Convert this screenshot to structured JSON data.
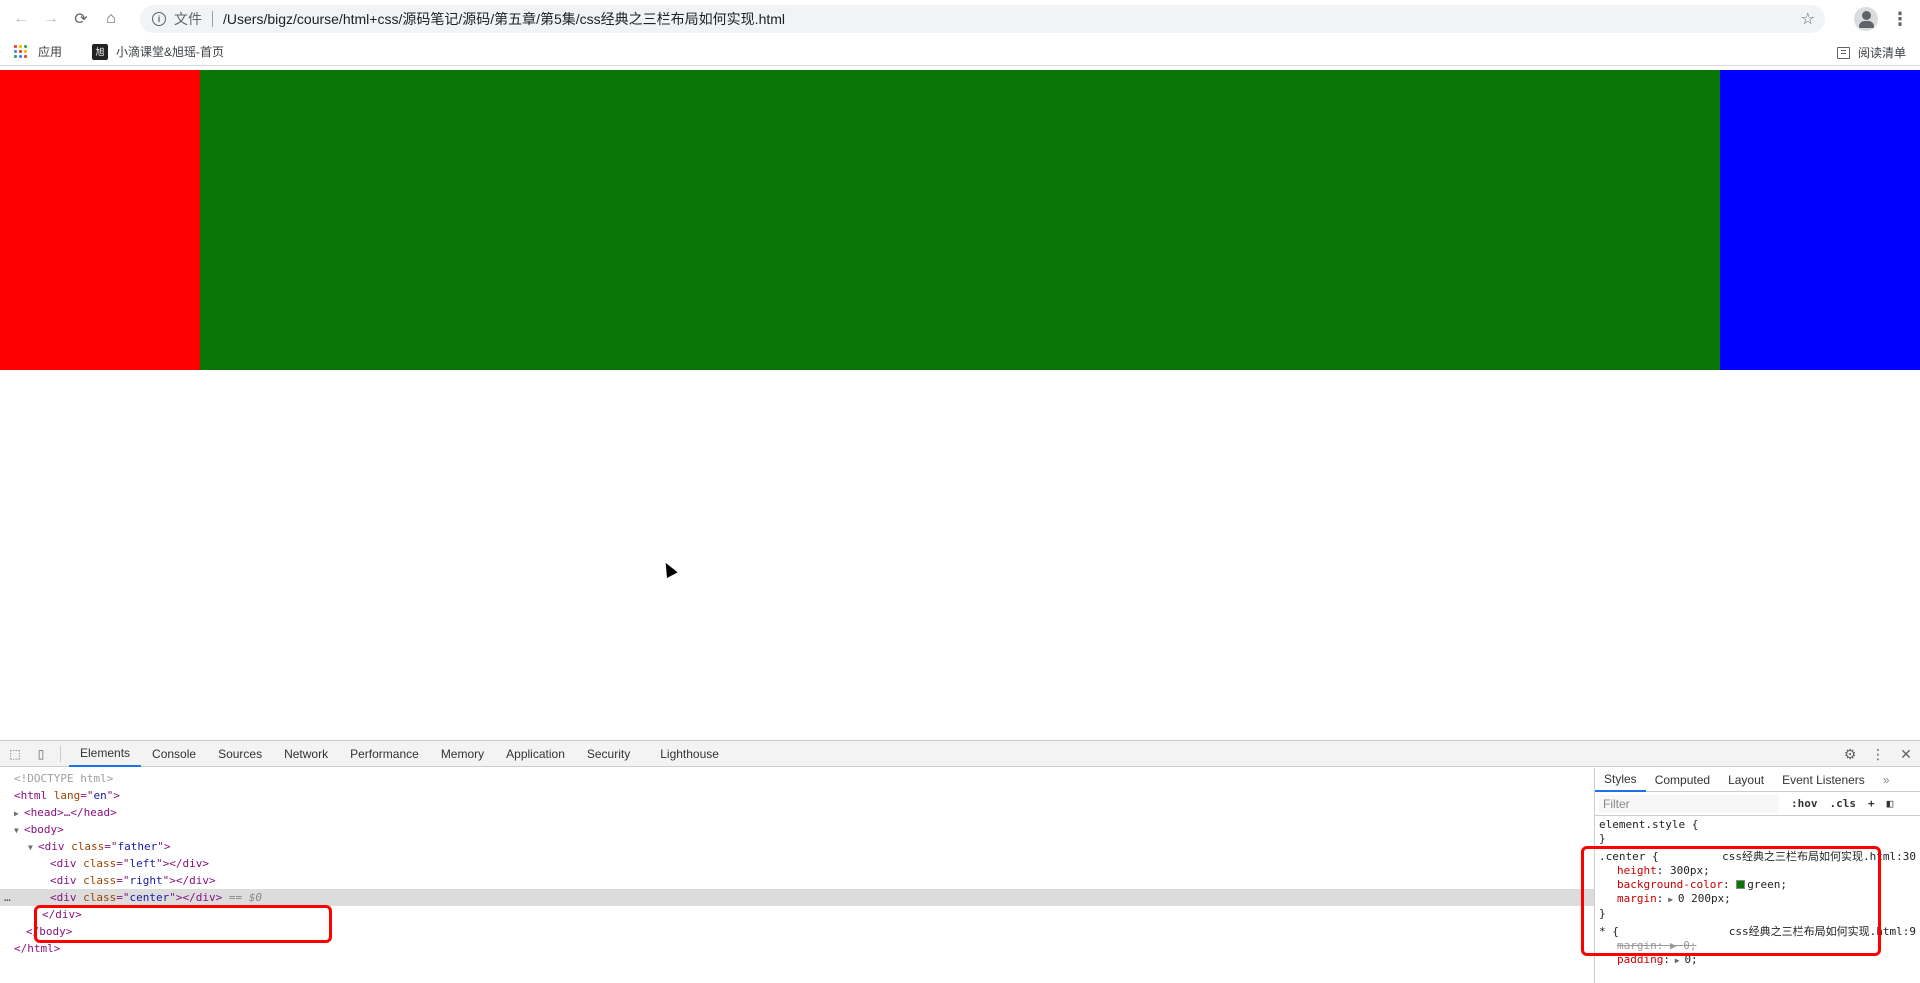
{
  "browser": {
    "protocol_label": "文件",
    "url": "/Users/bigz/course/html+css/源码笔记/源码/第五章/第5集/css经典之三栏布局如何实现.html"
  },
  "bookmarks": {
    "apps_label": "应用",
    "site_label": "小滴课堂&旭瑶-首页",
    "site_logo_text": "旭",
    "reading_list_label": "阅读清单"
  },
  "page": {
    "left_color": "#ff0000",
    "center_color": "#087507",
    "right_color": "#0000ff"
  },
  "devtools": {
    "tabs": [
      "Elements",
      "Console",
      "Sources",
      "Network",
      "Performance",
      "Memory",
      "Application",
      "Security",
      "Lighthouse"
    ],
    "active_tab": "Elements",
    "dom": {
      "doctype": "<!DOCTYPE html>",
      "html_open": "html",
      "html_attr": "lang",
      "html_val": "en",
      "head": "<head>…</head>",
      "body_open": "<body>",
      "father_attr": "class",
      "father_val": "father",
      "left_val": "left",
      "right_val": "right",
      "center_val": "center",
      "close_div": "</div>",
      "close_body": "</body>",
      "close_html": "</html>",
      "selected_marker": "== $0",
      "dots": "…"
    },
    "styles_tabs": [
      "Styles",
      "Computed",
      "Layout",
      "Event Listeners"
    ],
    "filter_placeholder": "Filter",
    "hov_label": ":hov",
    "cls_label": ".cls",
    "element_style": "element.style {",
    "close_brace": "}",
    "center_rule": {
      "selector": ".center {",
      "source": "css经典之三栏布局如何实现.html:30",
      "height_name": "height",
      "height_val": "300px;",
      "bg_name": "background-color",
      "bg_val": "green;",
      "margin_name": "margin",
      "margin_val": "0 200px;"
    },
    "universal_rule": {
      "selector": "* {",
      "source": "css经典之三栏布局如何实现.html:9",
      "margin_name": "margin",
      "margin_val": "0;",
      "padding_name": "padding",
      "padding_val": "0;"
    }
  }
}
